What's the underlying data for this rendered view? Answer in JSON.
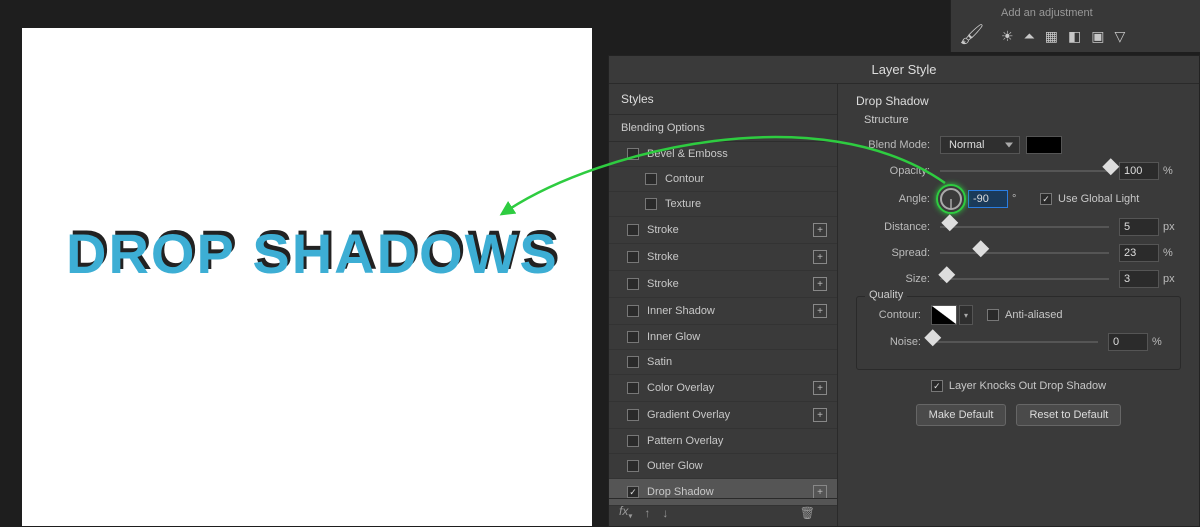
{
  "canvas": {
    "text": "DROP SHADOWS"
  },
  "adjustments": {
    "label": "Add an adjustment",
    "icons": [
      "brightness",
      "levels",
      "curves",
      "exposure",
      "vibrance",
      "more"
    ]
  },
  "layer_style": {
    "title": "Layer Style",
    "styles_header": "Styles",
    "blending_options": "Blending Options",
    "items": [
      {
        "label": "Bevel & Emboss",
        "checked": false,
        "add": false
      },
      {
        "label": "Contour",
        "checked": false,
        "indent": true
      },
      {
        "label": "Texture",
        "checked": false,
        "indent": true
      },
      {
        "label": "Stroke",
        "checked": false,
        "add": true
      },
      {
        "label": "Stroke",
        "checked": false,
        "add": true
      },
      {
        "label": "Stroke",
        "checked": false,
        "add": true
      },
      {
        "label": "Inner Shadow",
        "checked": false,
        "add": true
      },
      {
        "label": "Inner Glow",
        "checked": false
      },
      {
        "label": "Satin",
        "checked": false
      },
      {
        "label": "Color Overlay",
        "checked": false,
        "add": true
      },
      {
        "label": "Gradient Overlay",
        "checked": false,
        "add": true
      },
      {
        "label": "Pattern Overlay",
        "checked": false
      },
      {
        "label": "Outer Glow",
        "checked": false
      },
      {
        "label": "Drop Shadow",
        "checked": true,
        "add": true,
        "selected": true
      }
    ],
    "footer": {
      "fx": "fx",
      "up": "↑",
      "down": "↓",
      "trash": "🗑"
    },
    "settings": {
      "section": "Drop Shadow",
      "structure": "Structure",
      "blend_mode": {
        "label": "Blend Mode:",
        "value": "Normal"
      },
      "opacity": {
        "label": "Opacity:",
        "value": "100",
        "unit": "%",
        "pct": 100
      },
      "angle": {
        "label": "Angle:",
        "value": "-90",
        "unit": "°",
        "use_global": {
          "label": "Use Global Light",
          "checked": true
        }
      },
      "distance": {
        "label": "Distance:",
        "value": "5",
        "unit": "px",
        "pct": 5
      },
      "spread": {
        "label": "Spread:",
        "value": "23",
        "unit": "%",
        "pct": 23
      },
      "size": {
        "label": "Size:",
        "value": "3",
        "unit": "px",
        "pct": 3
      },
      "quality": {
        "label": "Quality",
        "contour": "Contour:",
        "anti": "Anti-aliased",
        "anti_checked": false,
        "noise": {
          "label": "Noise:",
          "value": "0",
          "unit": "%",
          "pct": 0
        }
      },
      "knockout": {
        "label": "Layer Knocks Out Drop Shadow",
        "checked": true
      },
      "make_default": "Make Default",
      "reset_default": "Reset to Default"
    }
  }
}
